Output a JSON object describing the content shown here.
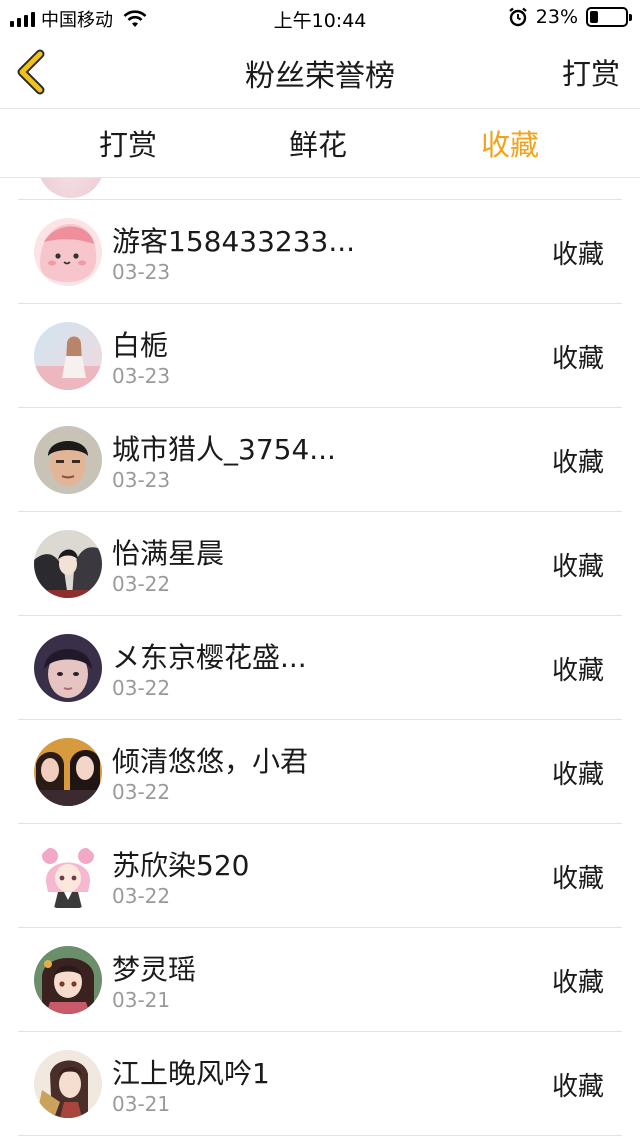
{
  "status_bar": {
    "carrier": "中国移动",
    "time": "上午10:44",
    "battery_percent_text": "23%",
    "battery_level": 0.23
  },
  "nav": {
    "title": "粉丝荣誉榜",
    "right_button": "打赏"
  },
  "tabs": [
    {
      "label": "打赏",
      "active": false
    },
    {
      "label": "鲜花",
      "active": false
    },
    {
      "label": "收藏",
      "active": true
    }
  ],
  "colors": {
    "accent": "#f0a41e",
    "divider": "#e3e3e3",
    "date_text": "#9a9a9a"
  },
  "list": [
    {
      "name": "游客158433233...",
      "date": "03-23",
      "action": "收藏",
      "avatar_icon": "pink-cartoon-avatar"
    },
    {
      "name": "白栀",
      "date": "03-23",
      "action": "收藏",
      "avatar_icon": "girl-photo-avatar"
    },
    {
      "name": "城市猎人_3754...",
      "date": "03-23",
      "action": "收藏",
      "avatar_icon": "boy-photo-avatar"
    },
    {
      "name": "怡满星晨",
      "date": "03-22",
      "action": "收藏",
      "avatar_icon": "anime-art-avatar"
    },
    {
      "name": "メ东京樱花盛...",
      "date": "03-22",
      "action": "收藏",
      "avatar_icon": "girl-selfie-avatar"
    },
    {
      "name": "倾清悠悠，小君",
      "date": "03-22",
      "action": "收藏",
      "avatar_icon": "two-girls-avatar"
    },
    {
      "name": "苏欣染520",
      "date": "03-22",
      "action": "收藏",
      "avatar_icon": "anime-pink-hair-avatar"
    },
    {
      "name": "梦灵瑶",
      "date": "03-21",
      "action": "收藏",
      "avatar_icon": "anime-girl-avatar"
    },
    {
      "name": "江上晚风吟1",
      "date": "03-21",
      "action": "收藏",
      "avatar_icon": "anime-guofeng-avatar"
    }
  ]
}
